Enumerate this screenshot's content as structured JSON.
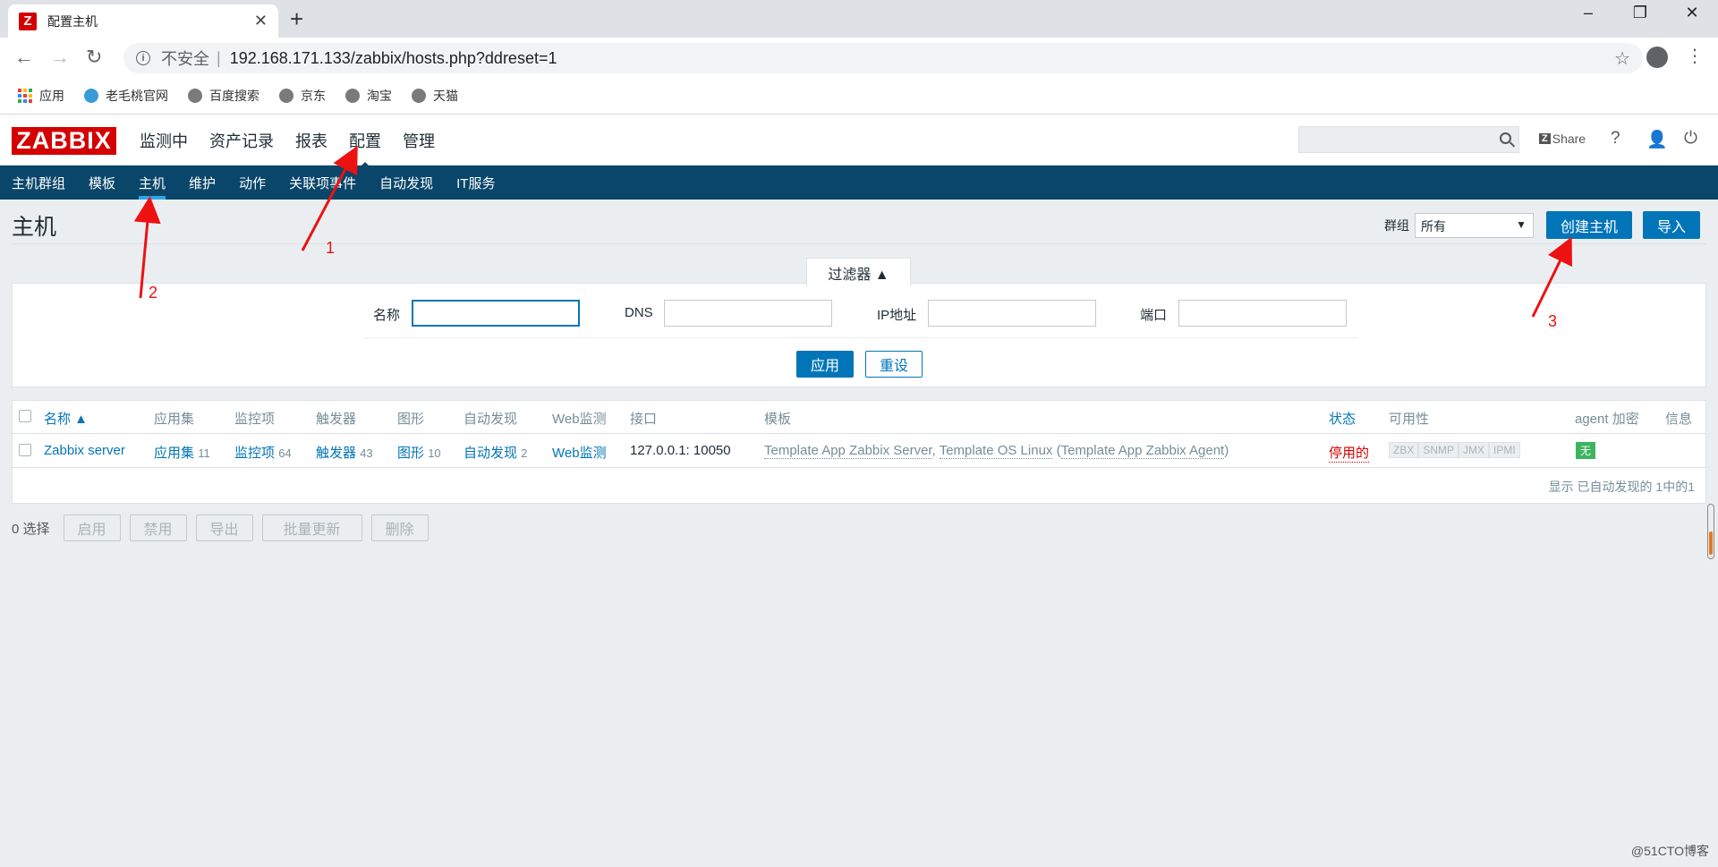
{
  "browser": {
    "tab_title": "配置主机",
    "favicon_letter": "Z",
    "url_insecure": "不安全",
    "url": "192.168.171.133/zabbix/hosts.php?ddreset=1",
    "bookmarks": [
      "应用",
      "老毛桃官网",
      "百度搜索",
      "京东",
      "淘宝",
      "天猫"
    ]
  },
  "header": {
    "logo": "ZABBIX",
    "menu": [
      "监测中",
      "资产记录",
      "报表",
      "配置",
      "管理"
    ],
    "share": "Share",
    "help": "?"
  },
  "submenu": [
    "主机群组",
    "模板",
    "主机",
    "维护",
    "动作",
    "关联项事件",
    "自动发现",
    "IT服务"
  ],
  "page": {
    "title": "主机",
    "group_label": "群组",
    "group_value": "所有",
    "create_host": "创建主机",
    "import": "导入"
  },
  "filter": {
    "tab": "过滤器 ▲",
    "name_label": "名称",
    "dns_label": "DNS",
    "ip_label": "IP地址",
    "port_label": "端口",
    "apply": "应用",
    "reset": "重设"
  },
  "table": {
    "headers": [
      "名称 ▲",
      "应用集",
      "监控项",
      "触发器",
      "图形",
      "自动发现",
      "Web监测",
      "接口",
      "模板",
      "状态",
      "可用性",
      "agent 加密",
      "信息"
    ],
    "row": {
      "name": "Zabbix server",
      "apps": "应用集",
      "apps_count": "11",
      "items": "监控项",
      "items_count": "64",
      "triggers": "触发器",
      "triggers_count": "43",
      "graphs": "图形",
      "graphs_count": "10",
      "discovery": "自动发现",
      "discovery_count": "2",
      "web": "Web监测",
      "interface": "127.0.0.1: 10050",
      "tpl1": "Template App Zabbix Server",
      "tpl2": "Template OS Linux",
      "tpl3": "Template App Zabbix Agent",
      "status": "停用的",
      "avail": [
        "ZBX",
        "SNMP",
        "JMX",
        "IPMI"
      ],
      "encryption": "无"
    },
    "footer": "显示 已自动发现的 1中的1"
  },
  "actions": {
    "selected": "0 选择",
    "buttons": [
      "启用",
      "禁用",
      "导出",
      "批量更新",
      "删除"
    ]
  },
  "annotations": [
    "1",
    "2",
    "3"
  ],
  "watermark": "@51CTO博客",
  "colors": {
    "brand": "#d40000",
    "nav": "#0a466a",
    "link": "#0275b8",
    "annotation": "#e11111"
  }
}
